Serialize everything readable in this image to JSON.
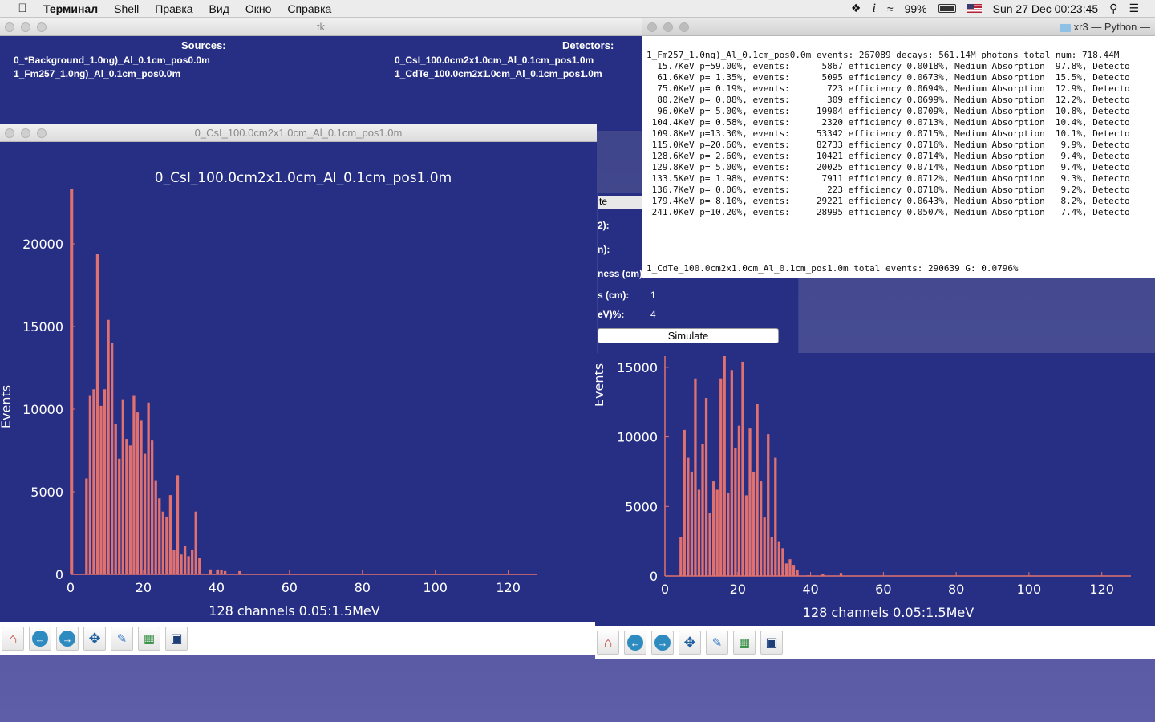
{
  "menubar": {
    "app": "Терминал",
    "items": [
      "Shell",
      "Правка",
      "Вид",
      "Окно",
      "Справка"
    ],
    "battery": "99%",
    "clock": "Sun 27 Dec  00:23:45"
  },
  "tk_window": {
    "title": "tk",
    "sources_label": "Sources:",
    "sources": [
      "0_*Background_1.0ng)_Al_0.1cm_pos0.0m",
      "1_Fm257_1.0ng)_Al_0.1cm_pos0.0m"
    ],
    "detectors_label": "Detectors:",
    "detectors": [
      "0_CsI_100.0cm2x1.0cm_Al_0.1cm_pos1.0m",
      "1_CdTe_100.0cm2x1.0cm_Al_0.1cm_pos1.0m"
    ]
  },
  "panel": {
    "tab_label": "te",
    "rows": [
      "2):",
      "n):",
      "ness (cm):",
      "s (cm):",
      "eV)%:"
    ],
    "value_1": "1",
    "value_2": "4",
    "simulate_label": "Simulate"
  },
  "terminal": {
    "title": "xr3 — Python —",
    "header": "1_Fm257_1.0ng)_Al_0.1cm_pos0.0m events: 267089 decays: 561.14M photons total num: 718.44M",
    "lines": [
      "  15.7KeV p=59.00%, events:      5867 efficiency 0.0018%, Medium Absorption  97.8%, Detecto",
      "  61.6KeV p= 1.35%, events:      5095 efficiency 0.0673%, Medium Absorption  15.5%, Detecto",
      "  75.0KeV p= 0.19%, events:       723 efficiency 0.0694%, Medium Absorption  12.9%, Detecto",
      "  80.2KeV p= 0.08%, events:       309 efficiency 0.0699%, Medium Absorption  12.2%, Detecto",
      "  96.0KeV p= 5.00%, events:     19904 efficiency 0.0709%, Medium Absorption  10.8%, Detecto",
      " 104.4KeV p= 0.58%, events:      2320 efficiency 0.0713%, Medium Absorption  10.4%, Detecto",
      " 109.8KeV p=13.30%, events:     53342 efficiency 0.0715%, Medium Absorption  10.1%, Detecto",
      " 115.0KeV p=20.60%, events:     82733 efficiency 0.0716%, Medium Absorption   9.9%, Detecto",
      " 128.6KeV p= 2.60%, events:     10421 efficiency 0.0714%, Medium Absorption   9.4%, Detecto",
      " 129.8KeV p= 5.00%, events:     20025 efficiency 0.0714%, Medium Absorption   9.4%, Detecto",
      " 133.5KeV p= 1.98%, events:      7911 efficiency 0.0712%, Medium Absorption   9.3%, Detecto",
      " 136.7KeV p= 0.06%, events:       223 efficiency 0.0710%, Medium Absorption   9.2%, Detecto",
      " 179.4KeV p= 8.10%, events:     29221 efficiency 0.0643%, Medium Absorption   8.2%, Detecto",
      " 241.0KeV p=10.20%, events:     28995 efficiency 0.0507%, Medium Absorption   7.4%, Detecto"
    ],
    "footer": "1_CdTe_100.0cm2x1.0cm_Al_0.1cm_pos1.0m total events: 290639 G: 0.0796%"
  },
  "toolbar_icons": [
    "home-icon",
    "back-icon",
    "forward-icon",
    "pan-icon",
    "zoom-icon",
    "configure-icon",
    "save-icon"
  ],
  "colors": {
    "plot_bg": "#272f84",
    "bars": "#e0716f",
    "axes": "#e0716f",
    "text": "#ffffff"
  },
  "plot1": {
    "window_title": "0_CsI_100.0cm2x1.0cm_Al_0.1cm_pos1.0m"
  },
  "chart_data": [
    {
      "type": "bar",
      "title": "0_CsI_100.0cm2x1.0cm_Al_0.1cm_pos1.0m",
      "xlabel": "128 channels 0.05:1.5MeV",
      "ylabel": "Events",
      "xlim": [
        0,
        128
      ],
      "ylim": [
        0,
        23300
      ],
      "xticks": [
        0,
        20,
        40,
        60,
        80,
        100,
        120
      ],
      "yticks": [
        0,
        5000,
        10000,
        15000,
        20000
      ],
      "grid": false,
      "x": [
        0,
        1,
        2,
        3,
        4,
        5,
        6,
        7,
        8,
        9,
        10,
        11,
        12,
        13,
        14,
        15,
        16,
        17,
        18,
        19,
        20,
        21,
        22,
        23,
        24,
        25,
        26,
        27,
        28,
        29,
        30,
        31,
        32,
        33,
        34,
        35,
        36,
        37,
        38,
        39,
        40,
        41,
        42,
        43,
        44,
        45,
        46,
        47,
        48,
        49,
        50
      ],
      "values": [
        23300,
        0,
        0,
        0,
        5800,
        10800,
        11200,
        19400,
        10200,
        11200,
        15400,
        14000,
        9100,
        7000,
        10600,
        8200,
        7800,
        10800,
        9800,
        9300,
        7300,
        10400,
        8100,
        5700,
        4600,
        3800,
        3500,
        4800,
        1500,
        6000,
        1200,
        1700,
        1100,
        1500,
        3800,
        1000,
        50,
        0,
        300,
        0,
        300,
        250,
        200,
        0,
        50,
        0,
        200,
        0,
        0,
        0,
        0
      ]
    },
    {
      "type": "bar",
      "title": "",
      "xlabel": "128 channels 0.05:1.5MeV",
      "ylabel": "Events",
      "xlim": [
        0,
        128
      ],
      "ylim": [
        0,
        15800
      ],
      "xticks": [
        0,
        20,
        40,
        60,
        80,
        100,
        120
      ],
      "yticks": [
        0,
        5000,
        10000,
        15000
      ],
      "grid": false,
      "x": [
        0,
        1,
        2,
        3,
        4,
        5,
        6,
        7,
        8,
        9,
        10,
        11,
        12,
        13,
        14,
        15,
        16,
        17,
        18,
        19,
        20,
        21,
        22,
        23,
        24,
        25,
        26,
        27,
        28,
        29,
        30,
        31,
        32,
        33,
        34,
        35,
        36,
        37,
        38,
        39,
        40,
        41,
        42,
        43,
        44,
        45,
        46,
        47,
        48,
        49,
        50
      ],
      "values": [
        0,
        0,
        0,
        0,
        2800,
        10500,
        8500,
        7500,
        14200,
        6200,
        9500,
        12800,
        4500,
        6800,
        6200,
        14200,
        15800,
        6000,
        14800,
        9200,
        10800,
        15400,
        5800,
        10600,
        7500,
        12400,
        6800,
        4200,
        10200,
        2800,
        8500,
        2500,
        2000,
        900,
        1200,
        800,
        450,
        0,
        0,
        50,
        0,
        0,
        0,
        120,
        0,
        0,
        0,
        0,
        220,
        0,
        0
      ]
    }
  ]
}
